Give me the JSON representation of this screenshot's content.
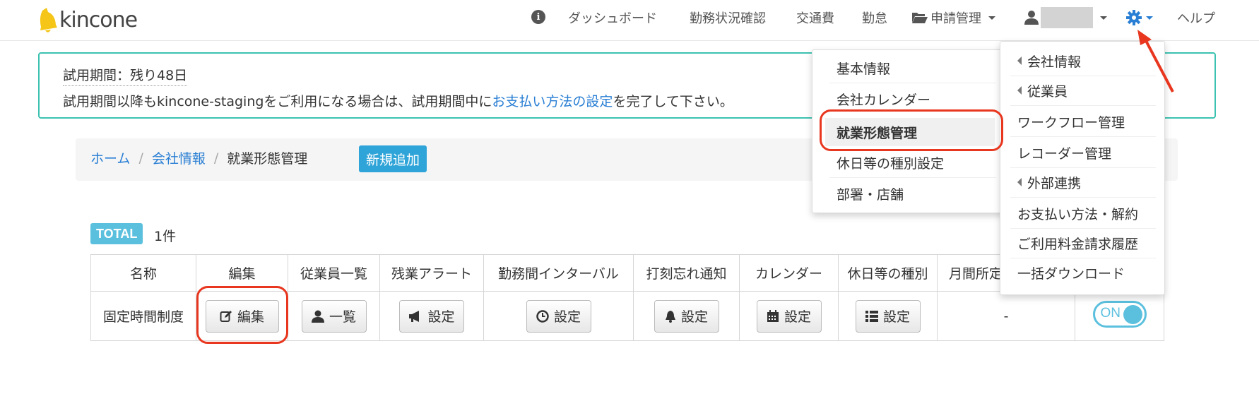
{
  "app": {
    "logo_text": "kincone"
  },
  "nav": {
    "info_glyph": "i",
    "dashboard": "ダッシュボード",
    "work_status": "勤務状況確認",
    "transport": "交通費",
    "attendance": "勤怠",
    "applications": "申請管理",
    "help": "ヘルプ"
  },
  "trial": {
    "title": "試用期間：残り48日",
    "body_before": "試用期間以降もkincone-stagingをご利用になる場合は、試用期間中に",
    "body_link": "お支払い方法の設定",
    "body_after": "を完了して下さい。"
  },
  "breadcrumb": {
    "home": "ホーム",
    "company": "会社情報",
    "current": "就業形態管理",
    "sep": "/",
    "add_button": "新規追加"
  },
  "total": {
    "badge": "TOTAL",
    "count": "1件"
  },
  "table": {
    "headers": [
      "名称",
      "編集",
      "従業員一覧",
      "残業アラート",
      "勤務間インターバル",
      "打刻忘れ通知",
      "カレンダー",
      "休日等の種別",
      "月間所定"
    ],
    "row": {
      "name": "固定時間制度",
      "edit": "編集",
      "employees": "一覧",
      "overtime": "設定",
      "interval": "設定",
      "forget_notice": "設定",
      "calendar": "設定",
      "holiday_type": "設定",
      "monthly": "-",
      "toggle": "ON"
    }
  },
  "company_submenu": {
    "items": [
      "基本情報",
      "会社カレンダー",
      "就業形態管理",
      "休日等の種別設定",
      "部署・店舗"
    ]
  },
  "settings_menu": {
    "items": [
      "会社情報",
      "従業員",
      "ワークフロー管理",
      "レコーダー管理",
      "外部連携",
      "お支払い方法・解約",
      "ご利用料金請求履歴",
      "一括ダウンロード"
    ]
  },
  "colors": {
    "accent": "#2fa4d8",
    "link": "#2a7fd4",
    "teal_border": "#3cc2b0",
    "toggle": "#5bc0de",
    "annotation": "#e8361f"
  }
}
